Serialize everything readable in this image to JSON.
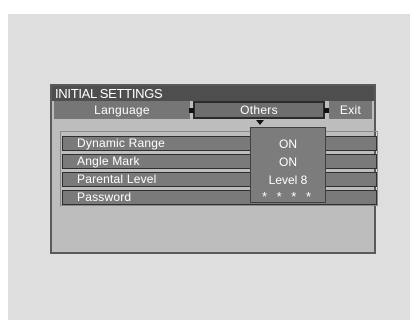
{
  "menu": {
    "title": "INITIAL SETTINGS"
  },
  "tabs": [
    {
      "label": "Language"
    },
    {
      "label": "Others"
    },
    {
      "label": "Exit"
    }
  ],
  "items": [
    {
      "label": "Dynamic Range",
      "value": "ON"
    },
    {
      "label": "Angle Mark",
      "value": "ON"
    },
    {
      "label": "Parental Level",
      "value": "Level 8"
    },
    {
      "label": "Password",
      "value": "* * * *"
    }
  ]
}
